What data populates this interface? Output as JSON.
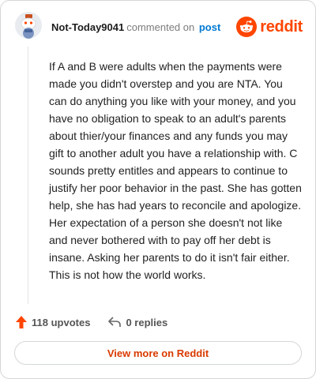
{
  "comment": {
    "author": "Not-Today9041",
    "action_text": "commented on",
    "post_link": "post",
    "body": "If A and B were adults when the payments were made you didn't overstep and you are NTA. You can do anything you like with your money, and you have no obligation to speak to an adult's parents about thier/your finances and any funds you may gift to another adult you have a relationship with. C sounds pretty entitles and appears to continue to justify her poor behavior in the past. She has gotten help, she has had years to reconcile and apologize. Her expectation of a person she doesn't not like and never bothered with to pay off her debt is insane. Asking her parents to do it isn't fair either. This is not how the world works."
  },
  "brand": {
    "name": "reddit",
    "icon": "reddit-logo-icon",
    "color": "#ff4500"
  },
  "actions": {
    "upvotes": "118 upvotes",
    "replies": "0 replies",
    "upvote_icon": "upvote-arrow-icon",
    "reply_icon": "reply-arrow-icon",
    "upvote_color": "#ff4500"
  },
  "footer": {
    "view_more_label": "View more on Reddit"
  }
}
